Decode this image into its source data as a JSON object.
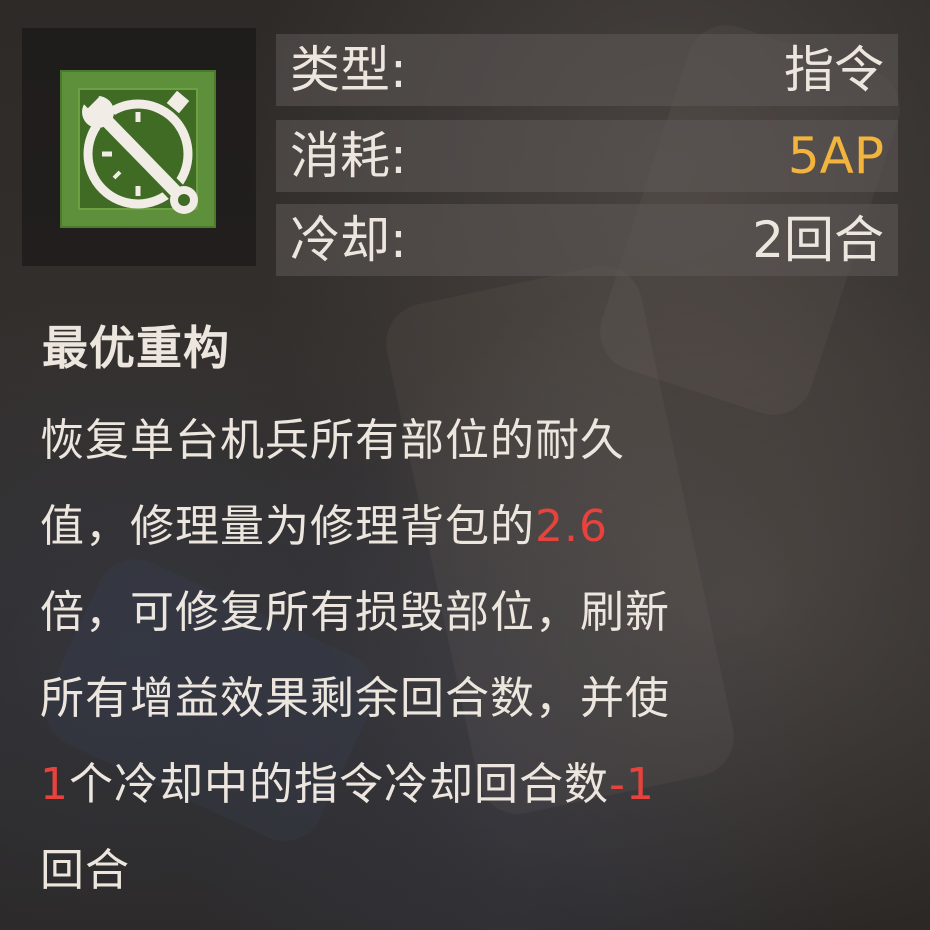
{
  "stats": {
    "type_label": "类型:",
    "type_value": "指令",
    "cost_label": "消耗:",
    "cost_value": "5AP",
    "cooldown_label": "冷却:",
    "cooldown_value": "2回合"
  },
  "skill": {
    "icon": "wrench-stopwatch-icon",
    "name": "最优重构",
    "description": {
      "line1": "恢复单台机兵所有部位的耐久",
      "line2_a": "值，修理量为修理背包的",
      "line2_num": "2.6",
      "line3": "倍，可修复所有损毁部位，刷新",
      "line4": "所有增益效果剩余回合数，并使",
      "line5_num": "1",
      "line5_a": "个冷却中的指令冷却回合数",
      "line5_num2": "-1",
      "line6": "回合"
    }
  },
  "colors": {
    "cost_orange": "#f2b43c",
    "highlight_red": "#e8423c",
    "icon_green": "#5e8f3a"
  }
}
